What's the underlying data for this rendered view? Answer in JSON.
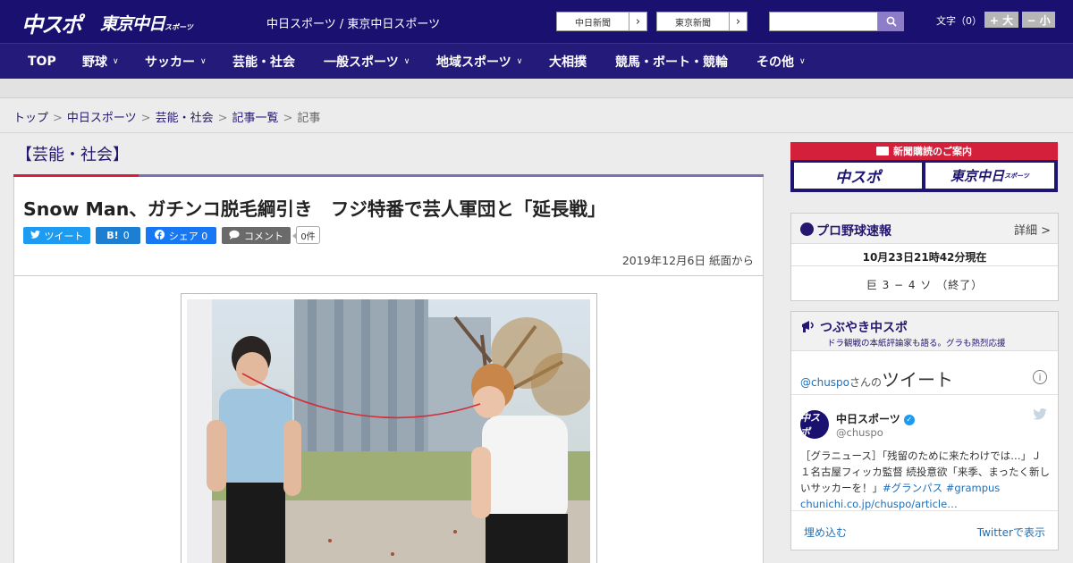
{
  "header": {
    "logo_chuspo": "中スポ",
    "logo_tokyo": "東京中日",
    "logo_tokyo_small": "スポーツ",
    "site_name": "中日スポーツ / 東京中日スポーツ",
    "ext_links": [
      {
        "label": "中日新聞"
      },
      {
        "label": "東京新聞"
      }
    ],
    "search_placeholder": "",
    "font_size_label": "文字（0）",
    "font_larger": "+ 大",
    "font_smaller": "− 小"
  },
  "nav": {
    "items": [
      {
        "label": "TOP",
        "has_menu": false
      },
      {
        "label": "野球",
        "has_menu": true
      },
      {
        "label": "サッカー",
        "has_menu": true
      },
      {
        "label": "芸能・社会",
        "has_menu": false
      },
      {
        "label": "一般スポーツ",
        "has_menu": true
      },
      {
        "label": "地域スポーツ",
        "has_menu": true
      },
      {
        "label": "大相撲",
        "has_menu": false
      },
      {
        "label": "競馬・ボート・競輪",
        "has_menu": false
      },
      {
        "label": "その他",
        "has_menu": true
      }
    ],
    "chevron": "∨"
  },
  "breadcrumb": {
    "items": [
      {
        "label": "トップ",
        "link": true
      },
      {
        "label": "中日スポーツ",
        "link": true
      },
      {
        "label": "芸能・社会",
        "link": true
      },
      {
        "label": "記事一覧",
        "link": true
      },
      {
        "label": "記事",
        "link": false
      }
    ],
    "separator": ">"
  },
  "article": {
    "category": "【芸能・社会】",
    "title": "Snow Man、ガチンコ脱毛綱引き　フジ特番で芸人軍団と「延長戦」",
    "share": {
      "tweet": "ツイート",
      "hatena_icon": "B!",
      "hatena_count": "0",
      "facebook": "シェア 0",
      "comment": "コメント",
      "comment_count": "0件"
    },
    "date": "2019年12月6日 紙面から"
  },
  "sidebar": {
    "subscribe_title": "新聞購読のご案内",
    "subscribe_chuspo": "中スポ",
    "subscribe_tokyo": "東京中日",
    "subscribe_tokyo_small": "スポーツ",
    "baseball": {
      "title": "プロ野球速報",
      "more": "詳細 >",
      "time": "10月23日21時42分現在",
      "score": "巨 3 − 4 ソ （終了）"
    },
    "tweets": {
      "title": "つぶやき中スポ",
      "subtitle": "ドラ観戦の本紙評論家も語る。グラも熱烈応援",
      "by_handle": "@chuspo",
      "by_suffix": "さんの",
      "by_word": "ツイート",
      "info": "i",
      "avatar_text": "中スポ",
      "name": "中日スポーツ",
      "verified": "✓",
      "handle": "@chuspo",
      "bird": "🐦",
      "text_1": "［グラニュース］「残留のために来たわけでは…」Ｊ１名古屋フィッカ監督 続投意欲「来季、まったく新しいサッカーを！」",
      "hashtags": "#グランパス #grampus",
      "link": "chunichi.co.jp/chuspo/article…",
      "embed": "埋め込む",
      "view_on_twitter": "Twitterで表示"
    }
  },
  "colors": {
    "header_bg": "#1a1070",
    "nav_bg": "#241a7a",
    "accent_red": "#d4203a",
    "accent_purple": "#7c6fb6",
    "tweet_blue": "#1d9bf0",
    "hatena_blue": "#1d7fd1",
    "facebook_blue": "#1877f2",
    "comment_gray": "#6a6a6a"
  }
}
